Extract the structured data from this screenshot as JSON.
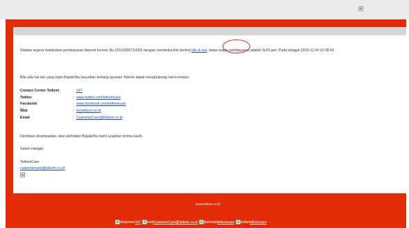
{
  "email": {
    "intro_text": "Silakan segera melakukan pembayaran deposit Invoice No.10110000710003 dengan membuka link berikut",
    "intro_link": "klik di sini",
    "intro_text_after": ", batas waktu pembayaran adalah 3x24 jam. Pada tanggal 2019-11-04 10:38:43.",
    "help_text": "Bila ada hal lain yang ingin Bapak/Ibu tanyakan tentang layanan Telkom dapat menghubungi kami melalui:",
    "contacts": [
      {
        "label": "Contact Center Telkom",
        "value": "147"
      },
      {
        "label": "Twitter",
        "value": "www.twitter.com/telkomcare"
      },
      {
        "label": "Facebook",
        "value": "www.facebook.com/telkomcare"
      },
      {
        "label": "Web",
        "value": "my.telkom.co.id"
      },
      {
        "label": "Email",
        "value": "CustomerCare@telkom.co.id"
      }
    ],
    "separator": ":",
    "closing_text": "Demikian disampaikan, atas perhatian Bapak/Ibu kami ucapkan terima kasih.",
    "greeting": "Salam Hangat,",
    "signature_name": "TelkomCare",
    "signature_email": "customercare@telkom.co.id"
  },
  "footer": {
    "site": "www.telkom.co.id",
    "items": [
      {
        "icon_alt": "telephone",
        "value": "147"
      },
      {
        "icon_alt": "mail",
        "value": "CustomerCare@telkom.co.id"
      },
      {
        "icon_alt": "facebook",
        "value": "telkomcare"
      },
      {
        "icon_alt": "twitter",
        "value": "telkomcare"
      }
    ]
  },
  "colors": {
    "brand_red": "#e12c07",
    "link_blue": "#1a4fb0",
    "annotation_circle": "#d8202a"
  },
  "icons": [
    "broken-image-icon"
  ]
}
